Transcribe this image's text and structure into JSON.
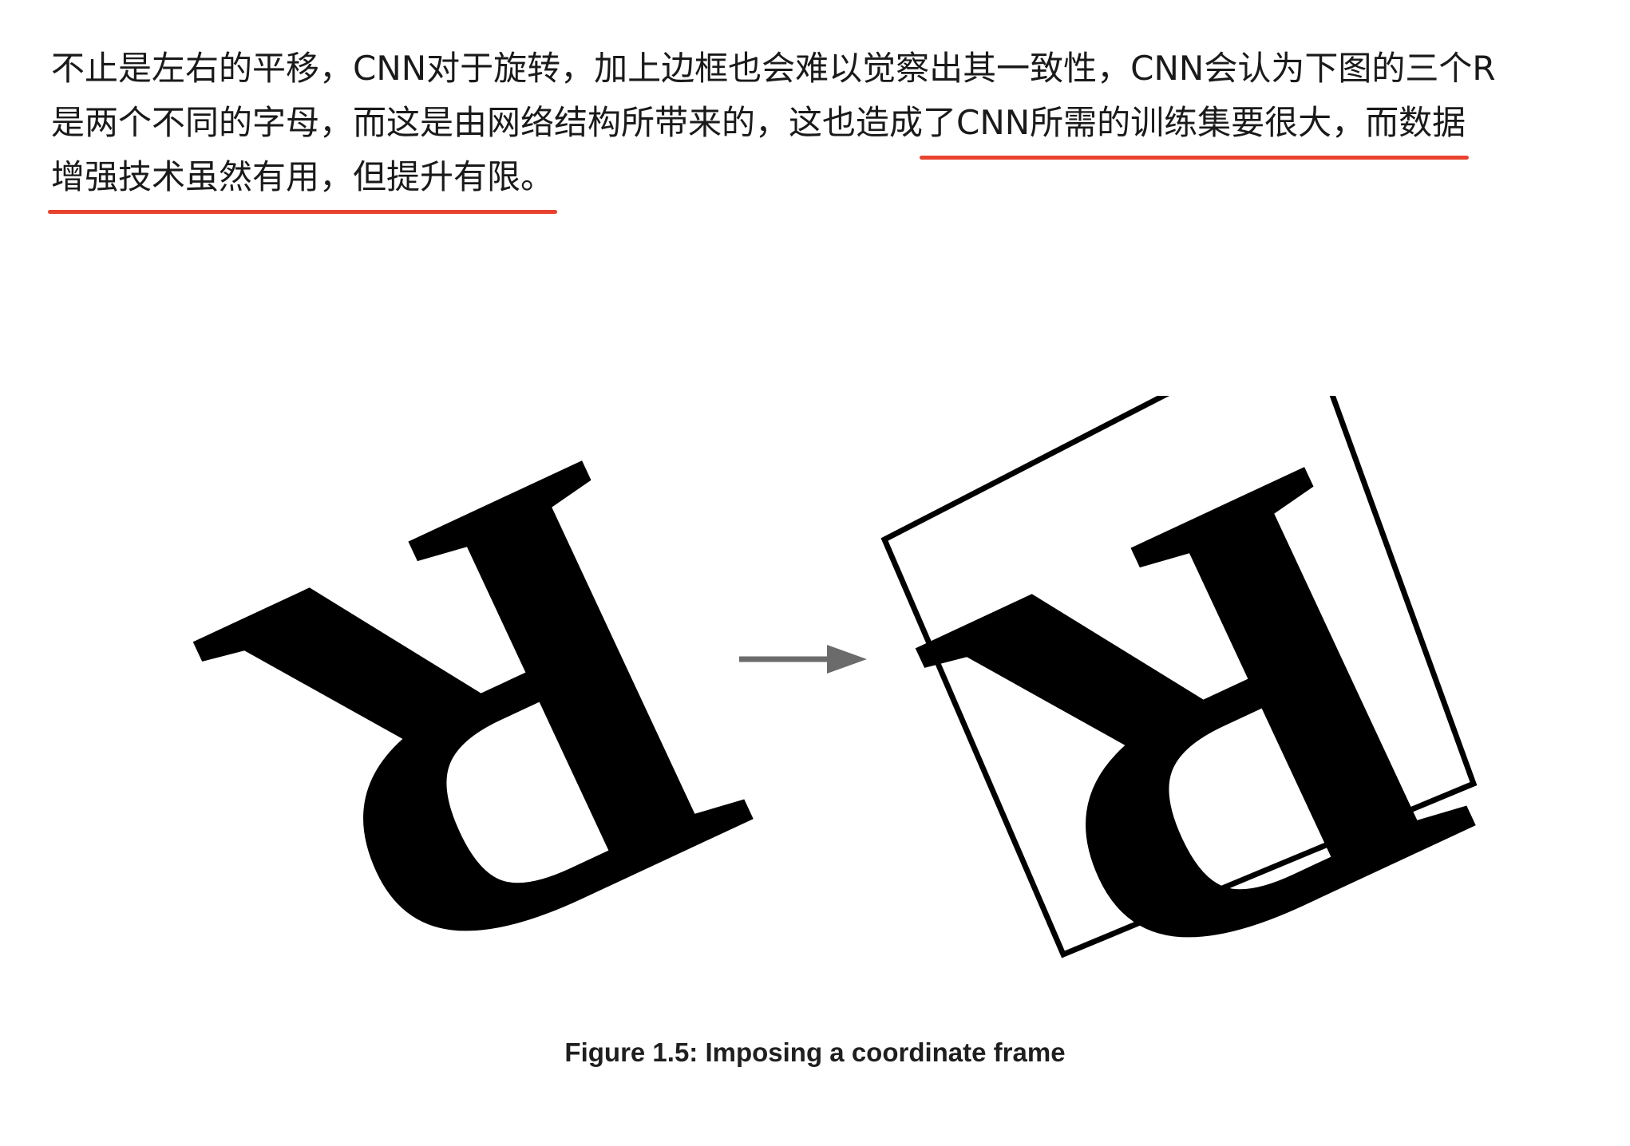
{
  "paragraph": {
    "line1": "不止是左右的平移，CNN对于旋转，加上边框也会难以觉察出其一致性，CNN会认为下图的三个R",
    "line2_plain": "是两个不同的字母，而这是由网络结构所带来的，这也造成",
    "line2_highlight": "了CNN所需的训练集要很大，而数据",
    "line3_highlight": "增强技术虽然有用，但提升有限。",
    "underline_color": "#e8432e"
  },
  "figure": {
    "glyph": "R",
    "caption": "Figure 1.5: Imposing a coordinate frame"
  }
}
